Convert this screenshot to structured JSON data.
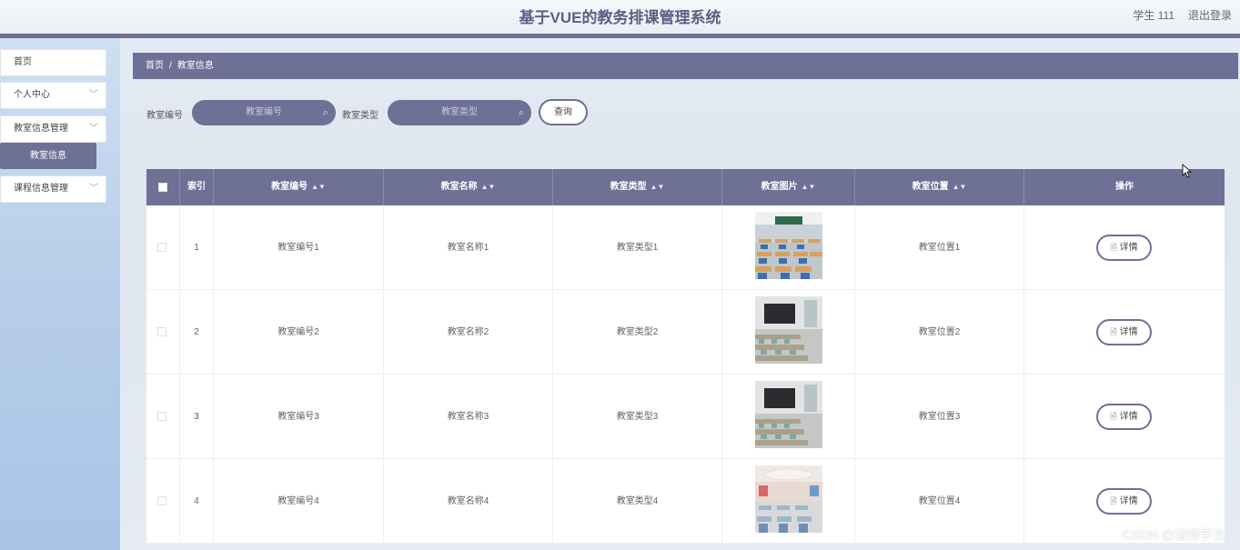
{
  "header": {
    "title": "基于VUE的教务排课管理系统",
    "user": "学生 111",
    "logout": "退出登录"
  },
  "sidebar": {
    "items": [
      {
        "label": "首页"
      },
      {
        "label": "个人中心"
      },
      {
        "label": "教室信息管理"
      },
      {
        "label": "课程信息管理"
      }
    ],
    "active_sub": "教室信息"
  },
  "breadcrumb": {
    "home": "首页",
    "separator": "/",
    "current": "教室信息"
  },
  "search": {
    "field1_label": "教室编号",
    "field1_placeholder": "教室编号",
    "field2_label": "教室类型",
    "field2_placeholder": "教室类型",
    "query_button": "查询"
  },
  "table": {
    "columns": [
      "索引",
      "教室编号",
      "教室名称",
      "教室类型",
      "教室图片",
      "教室位置",
      "操作"
    ],
    "detail_label": "详情",
    "rows": [
      {
        "index": "1",
        "code": "教室编号1",
        "name": "教室名称1",
        "type": "教室类型1",
        "location": "教室位置1"
      },
      {
        "index": "2",
        "code": "教室编号2",
        "name": "教室名称2",
        "type": "教室类型2",
        "location": "教室位置2"
      },
      {
        "index": "3",
        "code": "教室编号3",
        "name": "教室名称3",
        "type": "教室类型3",
        "location": "教室位置3"
      },
      {
        "index": "4",
        "code": "教室编号4",
        "name": "教室名称4",
        "type": "教室类型4",
        "location": "教室位置4"
      }
    ]
  },
  "watermark": "CSDN @涪陵学长",
  "colors": {
    "accent": "#6e7096",
    "sidebar": "#b8cfea"
  }
}
